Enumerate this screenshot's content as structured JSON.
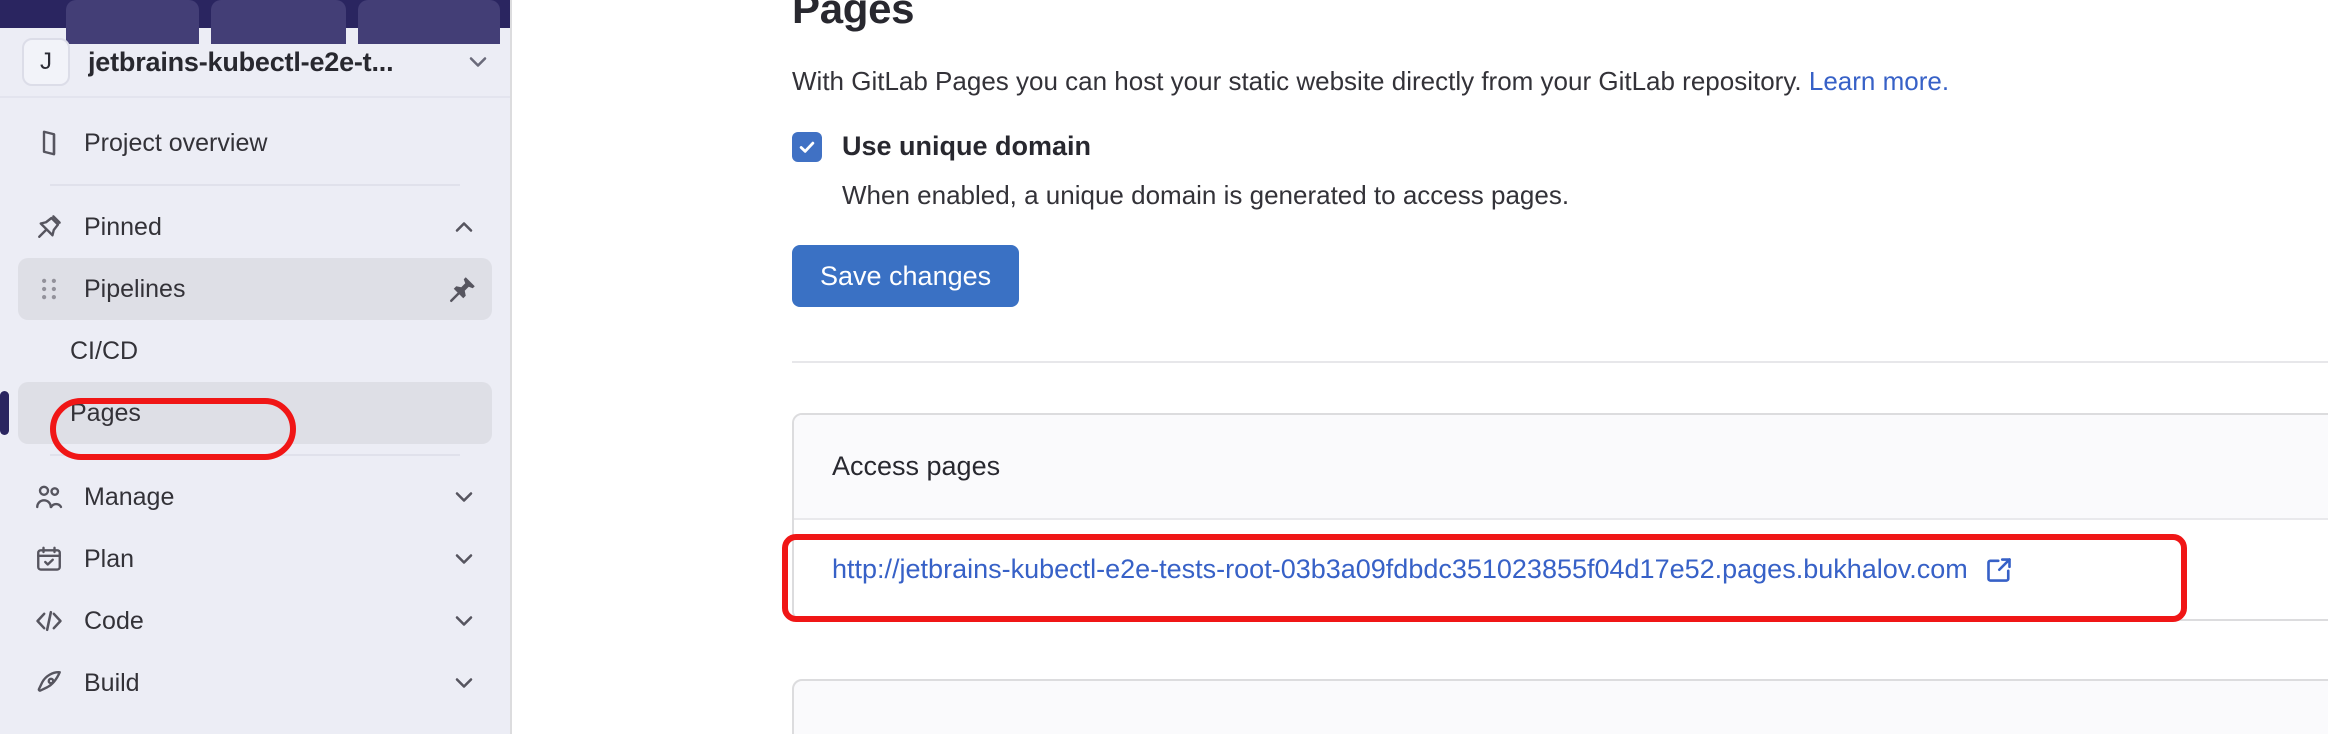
{
  "sidebar": {
    "topbar": {
      "chips": [
        "tab-chip-1",
        "tab-chip-2",
        "tab-chip-3"
      ]
    },
    "project": {
      "avatar_initial": "J",
      "name": "jetbrains-kubectl-e2e-t...",
      "chevron_icon": "chevron-down-icon"
    },
    "items": [
      {
        "label": "Project overview",
        "icon": "project-overview-icon",
        "type": "link"
      },
      {
        "label": "Pinned",
        "icon": "pin-icon",
        "type": "section",
        "trail_icon": "chevron-up-icon"
      },
      {
        "label": "Pipelines",
        "icon": "drag-handle-icon",
        "type": "pinned-item",
        "trail_icon": "pin-filled-icon"
      },
      {
        "label": "CI/CD",
        "type": "sub-item"
      },
      {
        "label": "Pages",
        "type": "sub-item",
        "current": true
      },
      {
        "label": "Manage",
        "icon": "users-icon",
        "type": "section",
        "trail_icon": "chevron-down-icon"
      },
      {
        "label": "Plan",
        "icon": "calendar-icon",
        "type": "section",
        "trail_icon": "chevron-down-icon"
      },
      {
        "label": "Code",
        "icon": "code-icon",
        "type": "section",
        "trail_icon": "chevron-down-icon"
      },
      {
        "label": "Build",
        "icon": "rocket-icon",
        "type": "section",
        "trail_icon": "chevron-down-icon"
      }
    ]
  },
  "main": {
    "title": "Pages",
    "description_text": "With GitLab Pages you can host your static website directly from your GitLab repository.",
    "description_link": "Learn more.",
    "unique_domain": {
      "checked": true,
      "label": "Use unique domain",
      "help": "When enabled, a unique domain is generated to access pages."
    },
    "save_button": "Save changes",
    "access_card": {
      "header": "Access pages",
      "url": "http://jetbrains-kubectl-e2e-tests-root-03b3a09fdbdc351023855f04d17e52.pages.bukhalov.com",
      "external_icon": "external-link-icon"
    }
  },
  "annotations": {
    "accent_color": "#f01616",
    "pages_highlight": "Pages",
    "url_highlight": "access-pages-url"
  },
  "colors": {
    "topbar_navy": "#2a2560",
    "sidebar_bg": "#ecedf5",
    "sidebar_active": "#dedfe6",
    "primary_button": "#3a71c4",
    "link_blue": "#3761c7",
    "checkbox_blue": "#4071c4",
    "annotation_red": "#f01616"
  }
}
